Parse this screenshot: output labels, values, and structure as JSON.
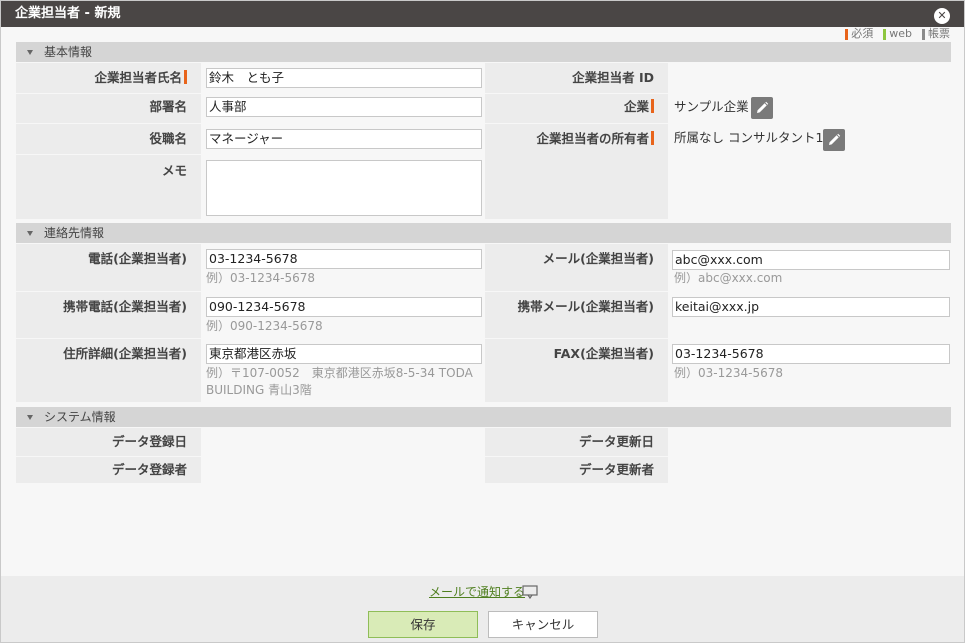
{
  "window": {
    "title": "企業担当者 - 新規",
    "close_label": "✕"
  },
  "legend": [
    {
      "label": "必須",
      "color": "#e8641b"
    },
    {
      "label": "web",
      "color": "#8dc63f"
    },
    {
      "label": "帳票",
      "color": "#8a8a8a"
    }
  ],
  "sections": {
    "basic": "基本情報",
    "contact": "連絡先情報",
    "system": "システム情報"
  },
  "basic": {
    "name_label": "企業担当者氏名",
    "name_value": "鈴木　とも子",
    "id_label": "企業担当者 ID",
    "dept_label": "部署名",
    "dept_value": "人事部",
    "company_label": "企業",
    "company_value": "サンプル企業",
    "title_label": "役職名",
    "title_value": "マネージャー",
    "owner_label": "企業担当者の所有者",
    "owner_value": "所属なし コンサルタント1",
    "memo_label": "メモ"
  },
  "contact": {
    "phone_label": "電話(企業担当者)",
    "phone_value": "03-1234-5678",
    "phone_hint": "例）03-1234-5678",
    "mail_label": "メール(企業担当者)",
    "mail_value": "abc@xxx.com",
    "mail_hint": "例）abc@xxx.com",
    "mobile_label": "携帯電話(企業担当者)",
    "mobile_value": "090-1234-5678",
    "mobile_hint": "例）090-1234-5678",
    "mobile_mail_label": "携帯メール(企業担当者)",
    "mobile_mail_value": "keitai@xxx.jp",
    "address_label": "住所詳細(企業担当者)",
    "address_value": "東京都港区赤坂",
    "address_hint_1": "例）〒107-0052　東京都港区赤坂8-5-34 TODA",
    "address_hint_2": "BUILDING 青山3階",
    "fax_label": "FAX(企業担当者)",
    "fax_value": "03-1234-5678",
    "fax_hint": "例）03-1234-5678"
  },
  "system": {
    "created_date_label": "データ登録日",
    "updated_date_label": "データ更新日",
    "created_by_label": "データ登録者",
    "updated_by_label": "データ更新者"
  },
  "footer": {
    "notify_label": "メールで通知する",
    "save_label": "保存",
    "cancel_label": "キャンセル"
  }
}
